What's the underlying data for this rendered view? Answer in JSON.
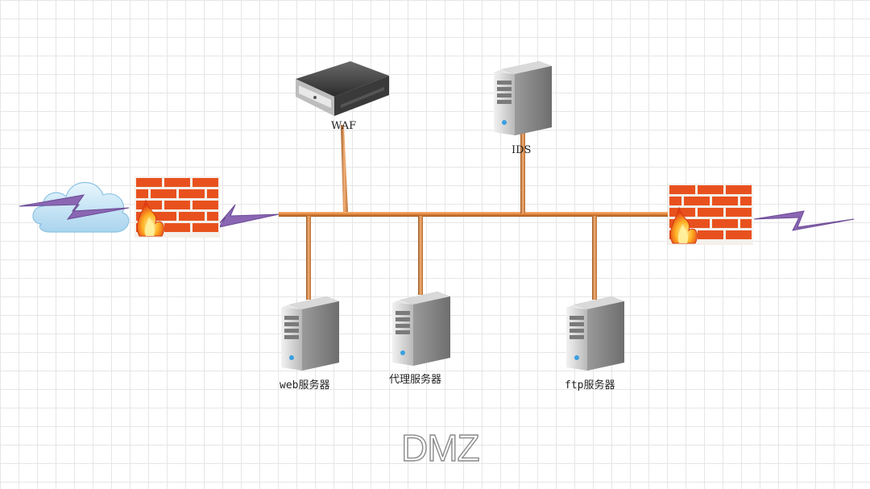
{
  "diagram": {
    "title": "DMZ",
    "nodes": {
      "internet": {
        "icon": "cloud-icon"
      },
      "firewall_left": {
        "icon": "firewall-icon"
      },
      "waf": {
        "label": "WAF",
        "icon": "appliance-icon"
      },
      "ids": {
        "label": "IDS",
        "icon": "server-icon"
      },
      "firewall_right": {
        "icon": "firewall-icon"
      },
      "web_server": {
        "label": "web服务器",
        "icon": "server-icon"
      },
      "proxy_server": {
        "label": "代理服务器",
        "icon": "server-icon"
      },
      "ftp_server": {
        "label": "ftp服务器",
        "icon": "server-icon"
      }
    },
    "colors": {
      "link": "#e48a3c",
      "brick": "#e8511e",
      "lightning": "#8a66b3",
      "cloud": "#bfe0f3"
    }
  }
}
